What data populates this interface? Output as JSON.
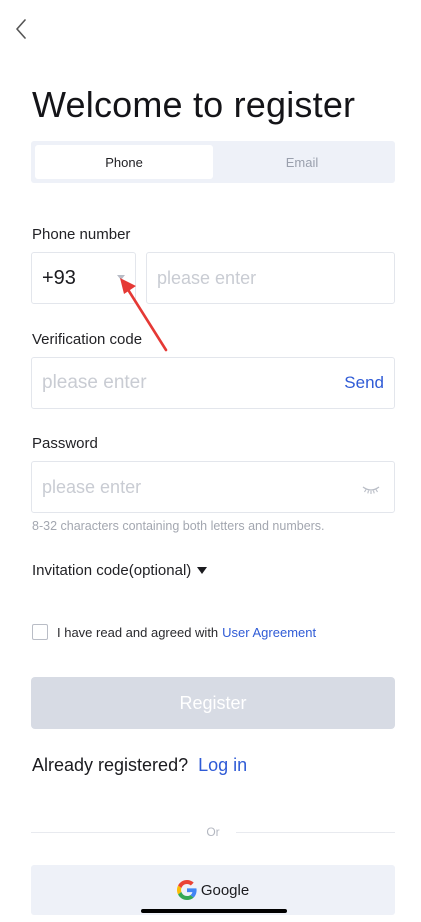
{
  "header": {
    "back_icon": "chevron-left-icon"
  },
  "title": "Welcome to register",
  "tabs": [
    {
      "label": "Phone",
      "active": true
    },
    {
      "label": "Email",
      "active": false
    }
  ],
  "phone": {
    "label": "Phone number",
    "country_code": "+93",
    "placeholder": "please enter"
  },
  "verification": {
    "label": "Verification code",
    "placeholder": "please enter",
    "send_label": "Send"
  },
  "password": {
    "label": "Password",
    "placeholder": "please enter",
    "hint": "8-32 characters containing both letters and numbers.",
    "toggle_icon": "eye-closed-icon"
  },
  "invitation": {
    "label": "Invitation code(optional)"
  },
  "agreement": {
    "checked": false,
    "text": "I have read and agreed with",
    "link": "User Agreement"
  },
  "register_label": "Register",
  "login": {
    "text": "Already registered?",
    "link": "Log in"
  },
  "divider_text": "Or",
  "google_label": "Google",
  "colors": {
    "accent": "#2f5bd6",
    "annotation_arrow": "#e53935"
  }
}
